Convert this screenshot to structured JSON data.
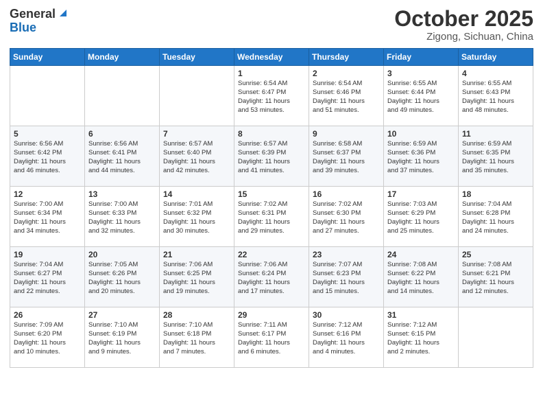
{
  "header": {
    "logo_general": "General",
    "logo_blue": "Blue",
    "title": "October 2025",
    "location": "Zigong, Sichuan, China"
  },
  "weekdays": [
    "Sunday",
    "Monday",
    "Tuesday",
    "Wednesday",
    "Thursday",
    "Friday",
    "Saturday"
  ],
  "weeks": [
    [
      {
        "day": "",
        "info": ""
      },
      {
        "day": "",
        "info": ""
      },
      {
        "day": "",
        "info": ""
      },
      {
        "day": "1",
        "info": "Sunrise: 6:54 AM\nSunset: 6:47 PM\nDaylight: 11 hours\nand 53 minutes."
      },
      {
        "day": "2",
        "info": "Sunrise: 6:54 AM\nSunset: 6:46 PM\nDaylight: 11 hours\nand 51 minutes."
      },
      {
        "day": "3",
        "info": "Sunrise: 6:55 AM\nSunset: 6:44 PM\nDaylight: 11 hours\nand 49 minutes."
      },
      {
        "day": "4",
        "info": "Sunrise: 6:55 AM\nSunset: 6:43 PM\nDaylight: 11 hours\nand 48 minutes."
      }
    ],
    [
      {
        "day": "5",
        "info": "Sunrise: 6:56 AM\nSunset: 6:42 PM\nDaylight: 11 hours\nand 46 minutes."
      },
      {
        "day": "6",
        "info": "Sunrise: 6:56 AM\nSunset: 6:41 PM\nDaylight: 11 hours\nand 44 minutes."
      },
      {
        "day": "7",
        "info": "Sunrise: 6:57 AM\nSunset: 6:40 PM\nDaylight: 11 hours\nand 42 minutes."
      },
      {
        "day": "8",
        "info": "Sunrise: 6:57 AM\nSunset: 6:39 PM\nDaylight: 11 hours\nand 41 minutes."
      },
      {
        "day": "9",
        "info": "Sunrise: 6:58 AM\nSunset: 6:37 PM\nDaylight: 11 hours\nand 39 minutes."
      },
      {
        "day": "10",
        "info": "Sunrise: 6:59 AM\nSunset: 6:36 PM\nDaylight: 11 hours\nand 37 minutes."
      },
      {
        "day": "11",
        "info": "Sunrise: 6:59 AM\nSunset: 6:35 PM\nDaylight: 11 hours\nand 35 minutes."
      }
    ],
    [
      {
        "day": "12",
        "info": "Sunrise: 7:00 AM\nSunset: 6:34 PM\nDaylight: 11 hours\nand 34 minutes."
      },
      {
        "day": "13",
        "info": "Sunrise: 7:00 AM\nSunset: 6:33 PM\nDaylight: 11 hours\nand 32 minutes."
      },
      {
        "day": "14",
        "info": "Sunrise: 7:01 AM\nSunset: 6:32 PM\nDaylight: 11 hours\nand 30 minutes."
      },
      {
        "day": "15",
        "info": "Sunrise: 7:02 AM\nSunset: 6:31 PM\nDaylight: 11 hours\nand 29 minutes."
      },
      {
        "day": "16",
        "info": "Sunrise: 7:02 AM\nSunset: 6:30 PM\nDaylight: 11 hours\nand 27 minutes."
      },
      {
        "day": "17",
        "info": "Sunrise: 7:03 AM\nSunset: 6:29 PM\nDaylight: 11 hours\nand 25 minutes."
      },
      {
        "day": "18",
        "info": "Sunrise: 7:04 AM\nSunset: 6:28 PM\nDaylight: 11 hours\nand 24 minutes."
      }
    ],
    [
      {
        "day": "19",
        "info": "Sunrise: 7:04 AM\nSunset: 6:27 PM\nDaylight: 11 hours\nand 22 minutes."
      },
      {
        "day": "20",
        "info": "Sunrise: 7:05 AM\nSunset: 6:26 PM\nDaylight: 11 hours\nand 20 minutes."
      },
      {
        "day": "21",
        "info": "Sunrise: 7:06 AM\nSunset: 6:25 PM\nDaylight: 11 hours\nand 19 minutes."
      },
      {
        "day": "22",
        "info": "Sunrise: 7:06 AM\nSunset: 6:24 PM\nDaylight: 11 hours\nand 17 minutes."
      },
      {
        "day": "23",
        "info": "Sunrise: 7:07 AM\nSunset: 6:23 PM\nDaylight: 11 hours\nand 15 minutes."
      },
      {
        "day": "24",
        "info": "Sunrise: 7:08 AM\nSunset: 6:22 PM\nDaylight: 11 hours\nand 14 minutes."
      },
      {
        "day": "25",
        "info": "Sunrise: 7:08 AM\nSunset: 6:21 PM\nDaylight: 11 hours\nand 12 minutes."
      }
    ],
    [
      {
        "day": "26",
        "info": "Sunrise: 7:09 AM\nSunset: 6:20 PM\nDaylight: 11 hours\nand 10 minutes."
      },
      {
        "day": "27",
        "info": "Sunrise: 7:10 AM\nSunset: 6:19 PM\nDaylight: 11 hours\nand 9 minutes."
      },
      {
        "day": "28",
        "info": "Sunrise: 7:10 AM\nSunset: 6:18 PM\nDaylight: 11 hours\nand 7 minutes."
      },
      {
        "day": "29",
        "info": "Sunrise: 7:11 AM\nSunset: 6:17 PM\nDaylight: 11 hours\nand 6 minutes."
      },
      {
        "day": "30",
        "info": "Sunrise: 7:12 AM\nSunset: 6:16 PM\nDaylight: 11 hours\nand 4 minutes."
      },
      {
        "day": "31",
        "info": "Sunrise: 7:12 AM\nSunset: 6:15 PM\nDaylight: 11 hours\nand 2 minutes."
      },
      {
        "day": "",
        "info": ""
      }
    ]
  ]
}
